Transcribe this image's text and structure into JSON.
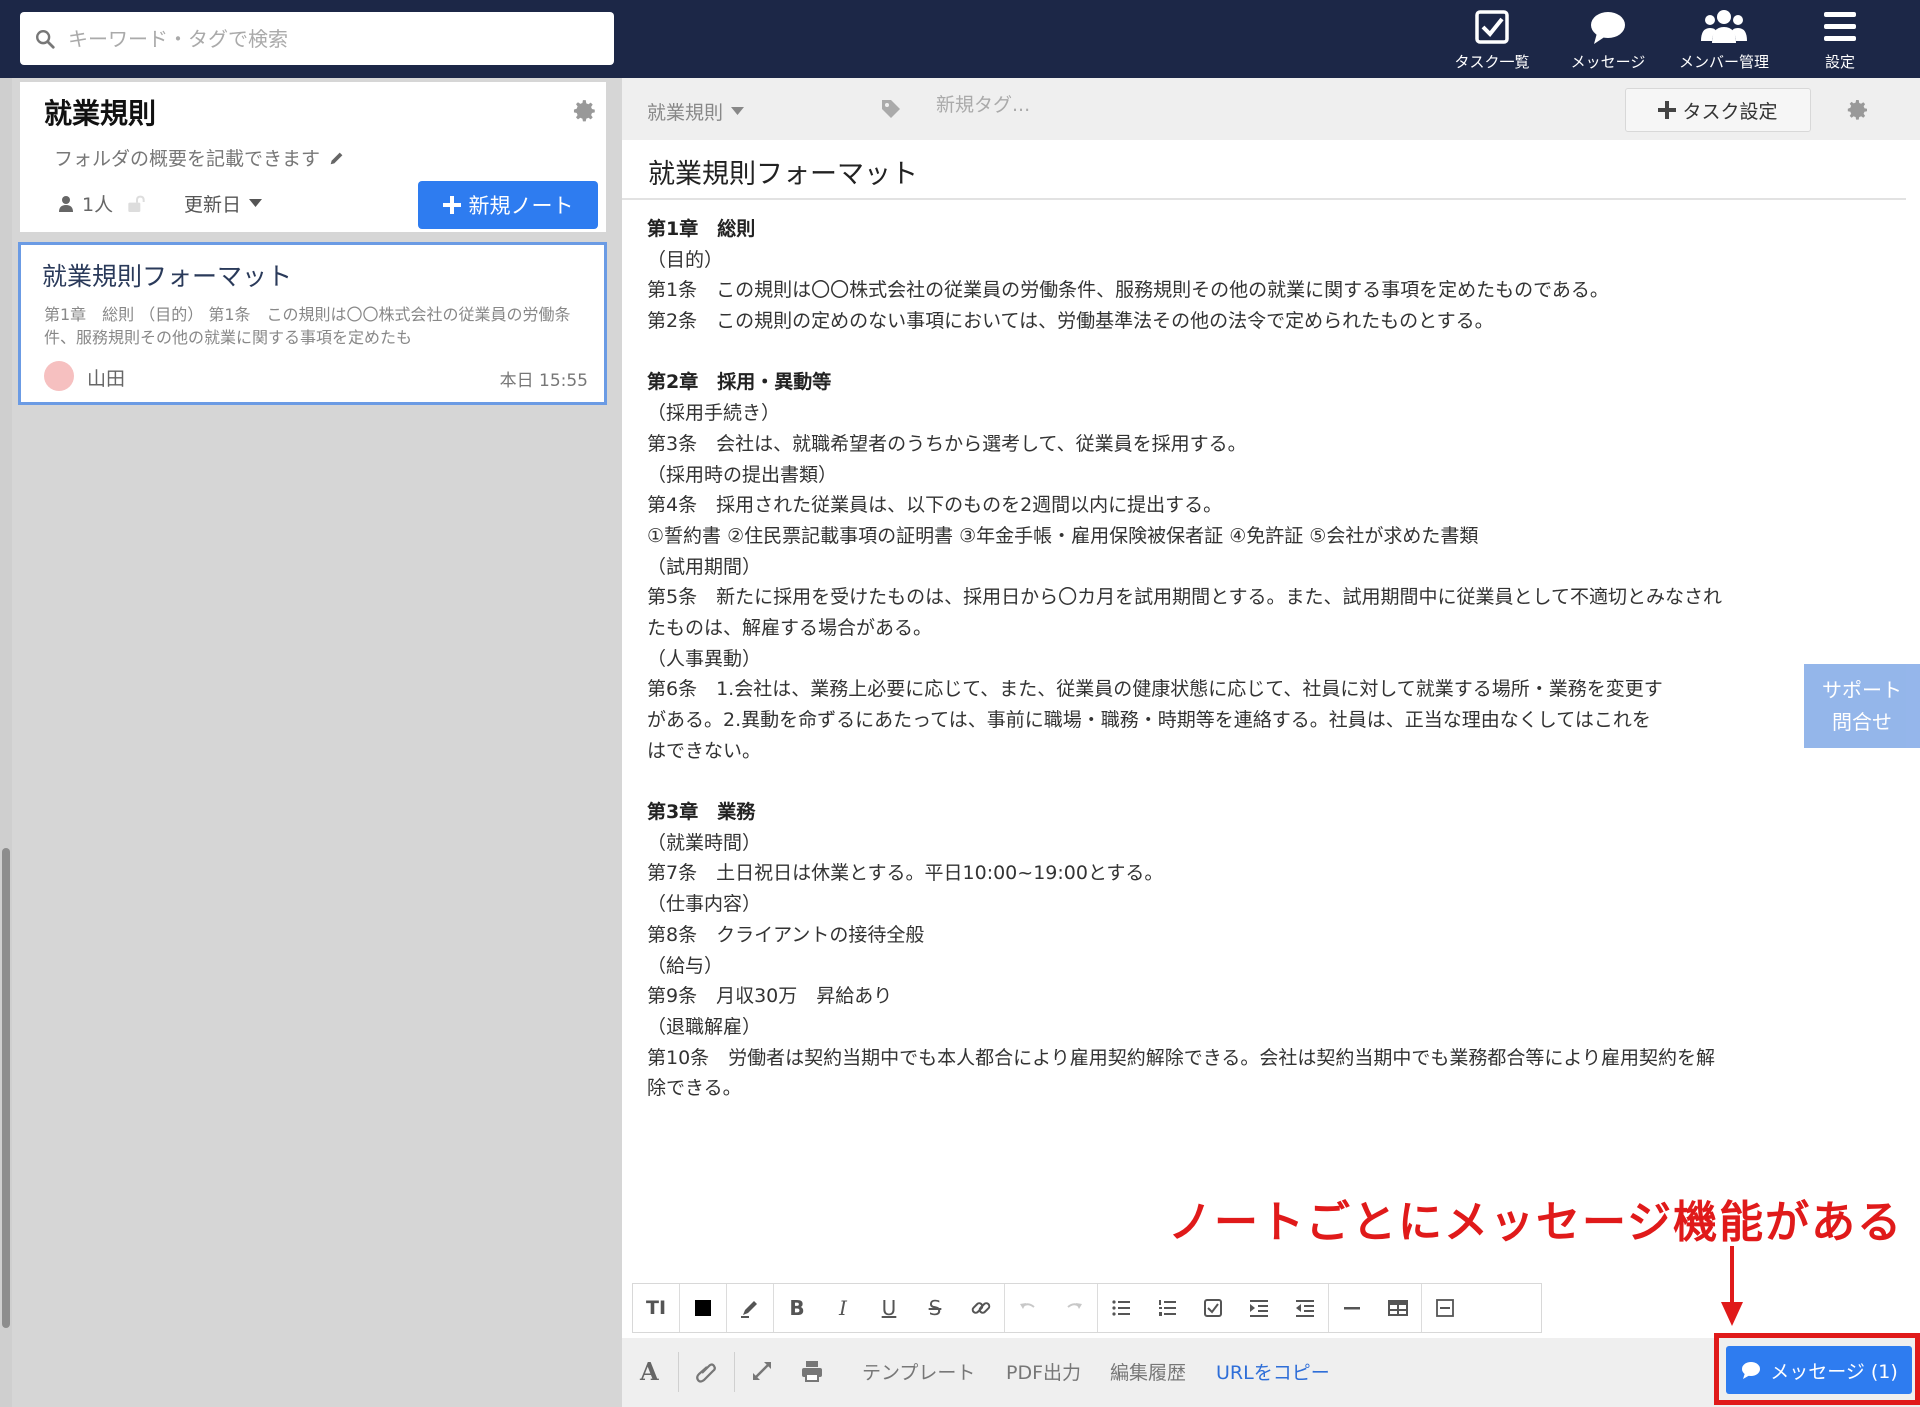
{
  "search": {
    "placeholder": "キーワード・タグで検索"
  },
  "nav": {
    "tasks": "タスク一覧",
    "messages": "メッセージ",
    "members": "メンバー管理",
    "settings": "設定"
  },
  "folder": {
    "title": "就業規則",
    "description": "フォルダの概要を記載できます",
    "members_count": "1人",
    "sort_label": "更新日",
    "new_note_label": "新規ノート"
  },
  "note_list": [
    {
      "title": "就業規則フォーマット",
      "snippet": "第1章　総則 （目的） 第1条　この規則は〇〇株式会社の従業員の労働条件、服務規則その他の就業に関する事項を定めたも",
      "author": "山田",
      "time": "本日 15:55"
    }
  ],
  "note_toolbar": {
    "folder_select": "就業規則",
    "tag_placeholder": "新規タグ...",
    "task_setting_label": "タスク設定"
  },
  "note": {
    "title": "就業規則フォーマット",
    "lines": [
      "第1章　総則",
      "（目的）",
      "第1条　この規則は〇〇株式会社の従業員の労働条件、服務規則その他の就業に関する事項を定めたものである。",
      "第2条　この規則の定めのない事項においては、労働基準法その他の法令で定められたものとする。",
      "",
      "第2章　採用・異動等",
      "（採用手続き）",
      "第3条　会社は、就職希望者のうちから選考して、従業員を採用する。",
      "（採用時の提出書類）",
      "第4条　採用された従業員は、以下のものを2週間以内に提出する。",
      "①誓約書 ②住民票記載事項の証明書 ③年金手帳・雇用保険被保者証 ④免許証 ⑤会社が求めた書類",
      "（試用期間）",
      "第5条　新たに採用を受けたものは、採用日から〇カ月を試用期間とする。また、試用期間中に従業員として不適切とみなされ",
      "たものは、解雇する場合がある。",
      "（人事異動）",
      "第6条　1.会社は、業務上必要に応じて、また、従業員の健康状態に応じて、社員に対して就業する場所・業務を変更す",
      "がある。2.異動を命ずるにあたっては、事前に職場・職務・時期等を連絡する。社員は、正当な理由なくしてはこれを",
      "はできない。",
      "",
      "第3章　業務",
      "（就業時間）",
      "第7条　土日祝日は休業とする。平日10:00~19:00とする。",
      "（仕事内容）",
      "第8条　クライアントの接待全般",
      "（給与）",
      "第9条　月収30万　昇給あり",
      "（退職解雇）",
      "第10条　労働者は契約当期中でも本人都合により雇用契約解除できる。会社は契約当期中でも業務都合等により雇用契約を解",
      "除できる。"
    ]
  },
  "support": {
    "line1": "サポート",
    "line2": "問合せ"
  },
  "annotation": "ノートごとにメッセージ機能がある",
  "format_toolbar": {
    "text_size": "TI",
    "bold": "B",
    "italic": "I",
    "underline": "U",
    "strike": "S"
  },
  "bottom_bar": {
    "font_icon": "A",
    "template": "テンプレート",
    "pdf": "PDF出力",
    "history": "編集履歴",
    "copy_url": "URLをコピー",
    "message_button": "メッセージ (1)"
  },
  "colors": {
    "topbar": "#1c2747",
    "accent": "#2e7cf0",
    "annotation": "#e01a1a"
  }
}
